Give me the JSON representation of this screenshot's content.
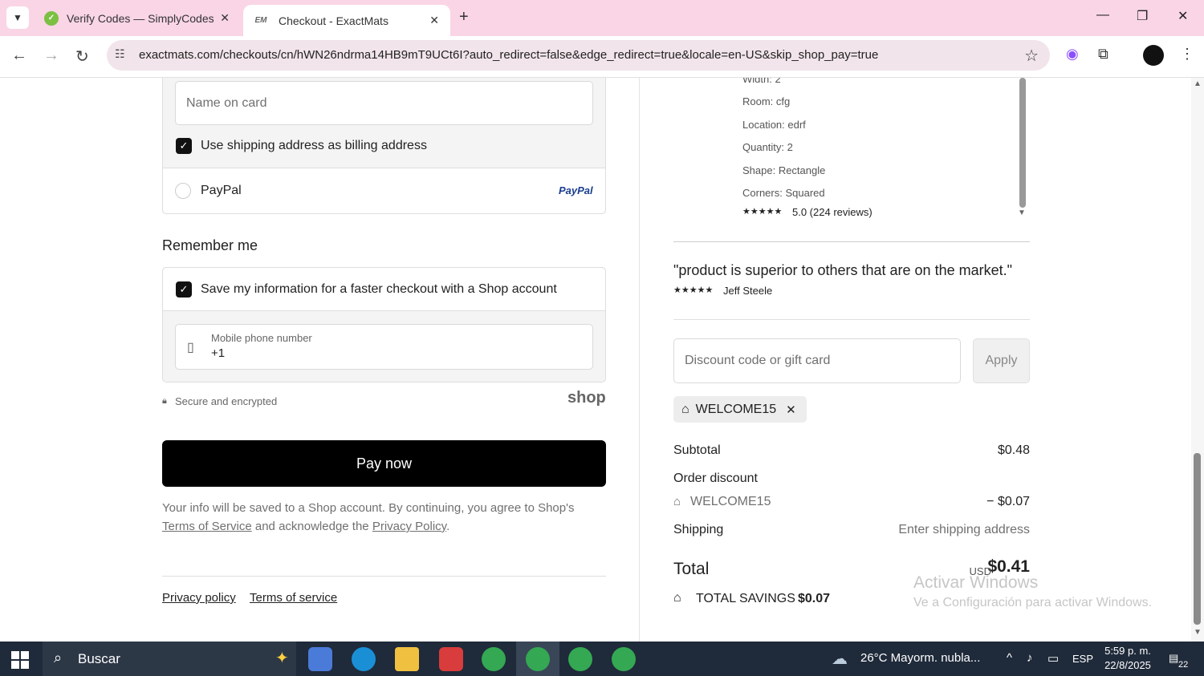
{
  "browser": {
    "tabs": [
      {
        "label": "Verify Codes — SimplyCodes",
        "active": false
      },
      {
        "label": "Checkout - ExactMats",
        "active": true
      }
    ],
    "url": "exactmats.com/checkouts/cn/hWN26ndrma14HB9mT9UCt6I?auto_redirect=false&edge_redirect=true&locale=en-US&skip_shop_pay=true",
    "active_tab_favicon_text": "EM"
  },
  "checkout": {
    "name_on_card_placeholder": "Name on card",
    "use_shipping_label": "Use shipping address as billing address",
    "paypal_label": "PayPal",
    "paypal_logo": "PayPal",
    "remember_title": "Remember me",
    "save_info_label": "Save my information for a faster checkout with a Shop account",
    "phone_label": "Mobile phone number",
    "phone_value": "+1",
    "secure_text": "Secure and encrypted",
    "shop_logo": "shop",
    "pay_now": "Pay now",
    "legal_text": "Your info will be saved to a Shop account. By continuing, you agree to Shop's",
    "terms_link": "Terms of Service",
    "legal_mid": "and acknowledge the",
    "privacy_link": "Privacy Policy",
    "legal_end": ".",
    "footer_privacy": "Privacy policy",
    "footer_terms": "Terms of service"
  },
  "summary": {
    "details": [
      "Width: 2",
      "Room: cfg",
      "Location: edrf",
      "Quantity: 2",
      "Shape: Rectangle",
      "Corners: Squared"
    ],
    "rating_stars": "★★★★★",
    "rating_text": "5.0 (224 reviews)",
    "quote": "\"product is superior to others that are on the market.\"",
    "quote_author": "Jeff Steele",
    "discount_placeholder": "Discount code or gift card",
    "apply_label": "Apply",
    "applied_code": "WELCOME15",
    "subtotal_label": "Subtotal",
    "subtotal_value": "$0.48",
    "order_discount_label": "Order discount",
    "discount_code_label": "WELCOME15",
    "discount_value": "− $0.07",
    "shipping_label": "Shipping",
    "shipping_value": "Enter shipping address",
    "total_label": "Total",
    "total_currency": "USD",
    "total_value": "$0.41",
    "savings_label": "TOTAL SAVINGS",
    "savings_value": "$0.07"
  },
  "watermark": {
    "line1": "Activar Windows",
    "line2": "Ve a Configuración para activar Windows."
  },
  "taskbar": {
    "search_placeholder": "Buscar",
    "weather": "26°C  Mayorm. nubla...",
    "language": "ESP",
    "time": "5:59 p. m.",
    "date": "22/8/2025",
    "notification_count": "22"
  }
}
